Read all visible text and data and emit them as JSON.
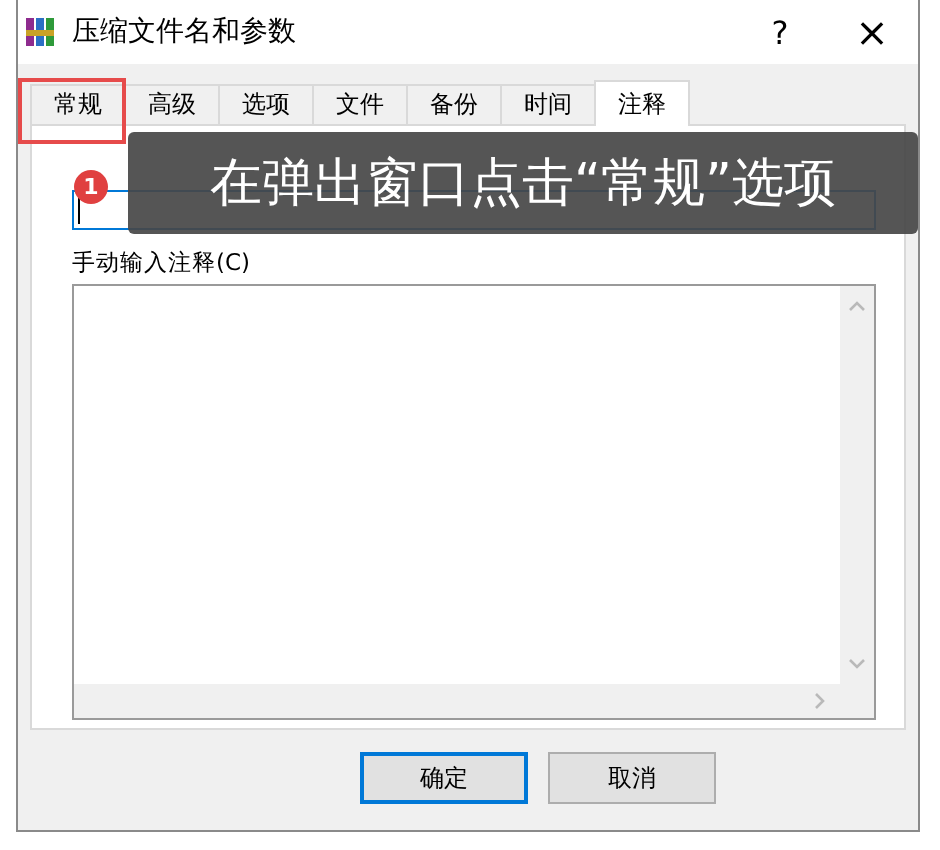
{
  "window": {
    "title": "压缩文件名和参数",
    "help": "?",
    "close": "×"
  },
  "tabs": [
    {
      "label": "常规",
      "selected": false
    },
    {
      "label": "高级",
      "selected": false
    },
    {
      "label": "选项",
      "selected": false
    },
    {
      "label": "文件",
      "selected": false
    },
    {
      "label": "备份",
      "selected": false
    },
    {
      "label": "时间",
      "selected": false
    },
    {
      "label": "注释",
      "selected": true
    }
  ],
  "comment": {
    "label": "手动输入注释(C)"
  },
  "buttons": [
    {
      "label": "确定",
      "default": true
    },
    {
      "label": "取消",
      "default": false
    }
  ],
  "annotation": {
    "step": "1",
    "text": "在弹出窗口点击“常规”选项"
  }
}
